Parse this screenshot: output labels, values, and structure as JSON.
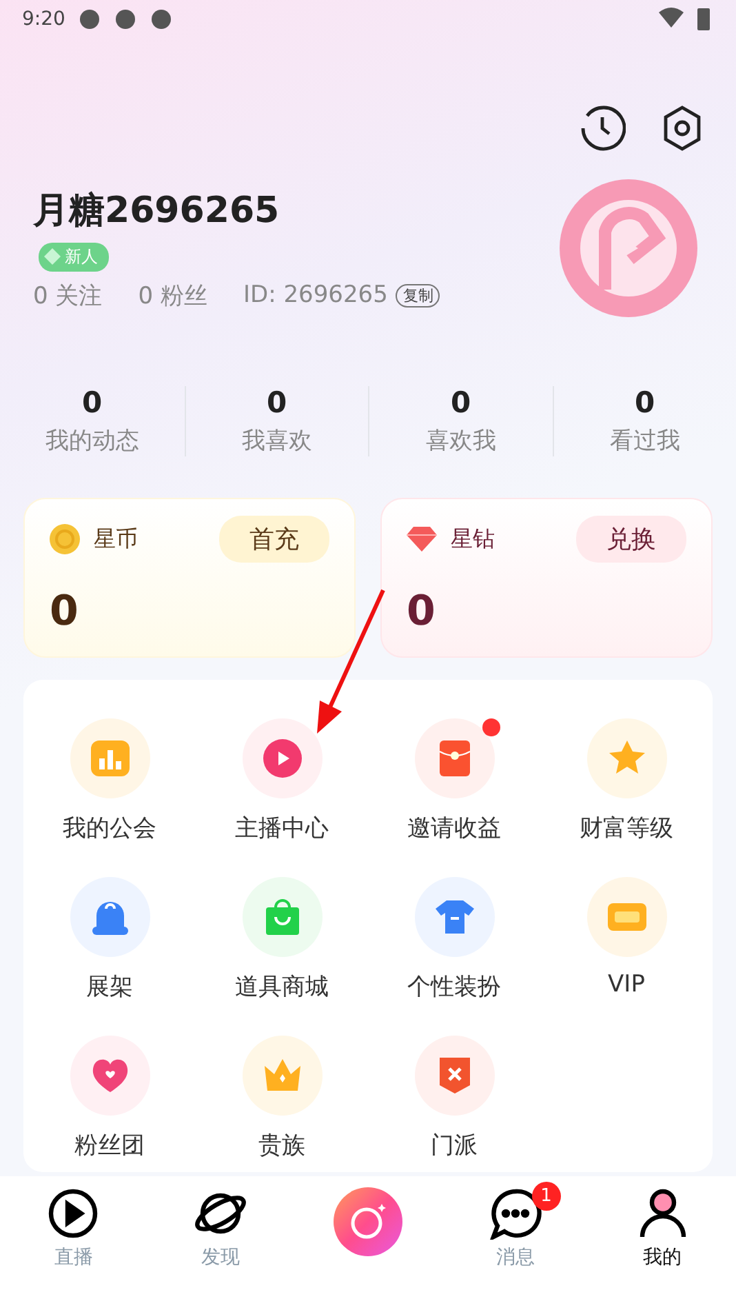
{
  "status_bar": {
    "time": "9:20"
  },
  "profile": {
    "name": "月糖2696265",
    "badge": "新人",
    "following": "0 关注",
    "fans": "0 粉丝",
    "id": "ID: 2696265",
    "copy": "复制"
  },
  "stats": [
    {
      "value": "0",
      "label": "我的动态"
    },
    {
      "value": "0",
      "label": "我喜欢"
    },
    {
      "value": "0",
      "label": "喜欢我"
    },
    {
      "value": "0",
      "label": "看过我"
    }
  ],
  "wallets": [
    {
      "kind": "coin",
      "label": "星币",
      "action": "首充",
      "amount": "0"
    },
    {
      "kind": "diamond",
      "label": "星钻",
      "action": "兑换",
      "amount": "0"
    }
  ],
  "features": [
    {
      "label": "我的公会",
      "dot": false
    },
    {
      "label": "主播中心",
      "dot": false
    },
    {
      "label": "邀请收益",
      "dot": true
    },
    {
      "label": "财富等级",
      "dot": false
    },
    {
      "label": "展架",
      "dot": false
    },
    {
      "label": "道具商城",
      "dot": false
    },
    {
      "label": "个性装扮",
      "dot": false
    },
    {
      "label": "VIP",
      "dot": false
    },
    {
      "label": "粉丝团",
      "dot": false
    },
    {
      "label": "贵族",
      "dot": false
    },
    {
      "label": "门派",
      "dot": false
    }
  ],
  "tab_bar": [
    {
      "kind": "tab",
      "label": "直播",
      "selected": false
    },
    {
      "kind": "tab",
      "label": "发现",
      "selected": false
    },
    {
      "kind": "camera"
    },
    {
      "kind": "tab",
      "label": "消息",
      "selected": false,
      "count": "1"
    },
    {
      "kind": "tab",
      "label": "我的",
      "selected": true
    }
  ]
}
